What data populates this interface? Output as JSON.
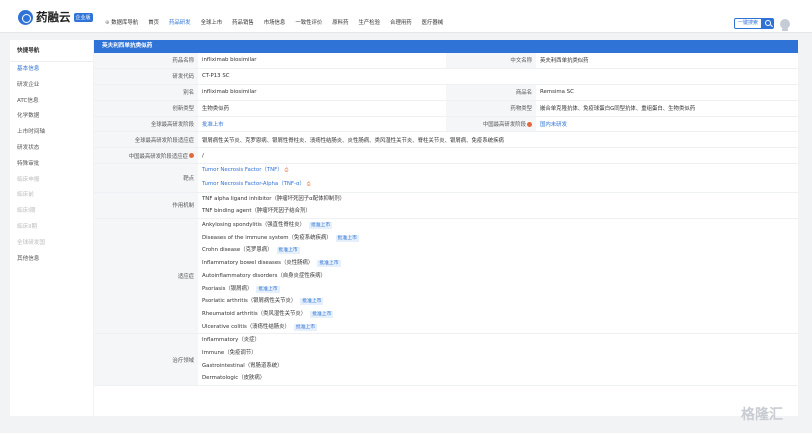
{
  "topbar": {
    "logo_text": "药融云",
    "badge": "企业版",
    "nav": [
      {
        "label": "数据库导航",
        "type": "db"
      },
      {
        "label": "首页"
      },
      {
        "label": "药品研发",
        "active": true
      },
      {
        "label": "全球上市"
      },
      {
        "label": "药品销售"
      },
      {
        "label": "市场信息"
      },
      {
        "label": "一致性评价"
      },
      {
        "label": "原料药"
      },
      {
        "label": "生产检验"
      },
      {
        "label": "合理用药"
      },
      {
        "label": "医疗器械"
      }
    ],
    "search_label": "一键搜索"
  },
  "sidebar": {
    "title": "快捷导航",
    "items": [
      {
        "label": "基本信息",
        "state": "active"
      },
      {
        "label": "研发企业",
        "state": "normal"
      },
      {
        "label": "ATC信息",
        "state": "normal"
      },
      {
        "label": "化学数据",
        "state": "normal"
      },
      {
        "label": "上市时间轴",
        "state": "normal"
      },
      {
        "label": "研发状态",
        "state": "normal"
      },
      {
        "label": "特殊审批",
        "state": "normal"
      },
      {
        "label": "临床申报",
        "state": "disabled"
      },
      {
        "label": "临床前",
        "state": "disabled"
      },
      {
        "label": "临床I期",
        "state": "disabled"
      },
      {
        "label": "临床II期",
        "state": "disabled"
      },
      {
        "label": "全球研发国",
        "state": "disabled"
      },
      {
        "label": "其他信息",
        "state": "normal"
      }
    ]
  },
  "main": {
    "header": "英夫利西单抗类似药",
    "drug_name_label": "药品名称",
    "drug_name": "infliximab biosimilar",
    "cn_name_label": "中文名称",
    "cn_name": "英夫利西单抗类似药",
    "code_label": "研发代码",
    "code": "CT-P13 SC",
    "alias_label": "别名",
    "alias": "infliximab biosimilar",
    "trade_label": "商品名",
    "trade": "Remsima SC",
    "innov_label": "创新类型",
    "innov": "生物类似药",
    "druglike_label": "药物类型",
    "druglike": "嵌合单克隆抗体、免疫球蛋白G同型抗体、重组蛋白、生物类似药",
    "global_stage_label": "全球最高研发阶段",
    "global_stage": "批准上市",
    "china_stage_label": "中国最高研发阶段",
    "china_stage": "国内未研发",
    "global_ind_label": "全球最高研发阶段适应症",
    "global_ind": "银屑病性关节炎、克罗恩病、银屑性脊柱炎、溃疡性结肠炎、炎性肠病、类风湿性关节炎、脊柱关节炎、银屑病、免疫系统疾病",
    "china_ind_label": "中国最高研发阶段适应症",
    "china_ind": "/",
    "target_label": "靶点",
    "targets": [
      "Tumor Necrosis Factor（TNF）",
      "Tumor Necrosis Factor-Alpha（TNF-α）"
    ],
    "pdf_icon": "pdf-icon",
    "mech_label": "作用机制",
    "mechs": [
      "TNF alpha ligand inhibitor（肿瘤坏死因子α配体抑制剂）",
      "TNF binding agent（肿瘤坏死因子结合剂）"
    ],
    "indication_label": "适应症",
    "indications": [
      {
        "name": "Ankylosing spondylitis（强直性脊柱炎）",
        "tag": "批准上市"
      },
      {
        "name": "Diseases of the immune system（免疫系统疾病）",
        "tag": "批准上市"
      },
      {
        "name": "Crohn disease（克罗恩病）",
        "tag": "批准上市"
      },
      {
        "name": "Inflammatory bowel diseases（炎性肠病）",
        "tag": "批准上市"
      },
      {
        "name": "Autoinflammatory disorders（自身炎症性疾病）",
        "tag": ""
      },
      {
        "name": "Psoriasis（银屑病）",
        "tag": "批准上市"
      },
      {
        "name": "Psoriatic arthritis（银屑病性关节炎）",
        "tag": "批准上市"
      },
      {
        "name": "Rheumatoid arthritis（类风湿性关节炎）",
        "tag": "批准上市"
      },
      {
        "name": "Ulcerative colitis（溃疡性结肠炎）",
        "tag": "批准上市"
      }
    ],
    "area_label": "治疗领域",
    "areas": [
      "Inflammatory（炎症）",
      "Immune（免疫调节）",
      "Gastrointestinal（胃肠道系统）",
      "Dermatologic（皮肤病）"
    ]
  },
  "watermark": "格隆汇",
  "colors": {
    "accent": "#2f73d6",
    "info": "#e46a3c"
  }
}
